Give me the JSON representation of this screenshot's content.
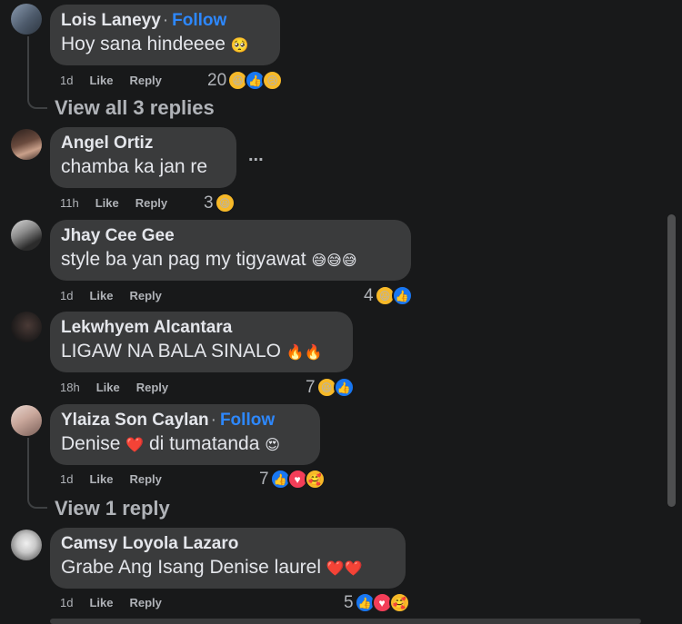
{
  "comments": [
    {
      "author": "Lois Laneyy",
      "follow": "Follow",
      "text": "Hoy sana hindeeee",
      "text_emoji": "🥺",
      "time": "1d",
      "like_label": "Like",
      "reply_label": "Reply",
      "reactions": {
        "count": "20",
        "icons": [
          "haha",
          "like",
          "sad"
        ]
      },
      "view_replies": "View all 3 replies"
    },
    {
      "author": "Angel Ortiz",
      "text": "chamba ka jan re",
      "time": "11h",
      "like_label": "Like",
      "reply_label": "Reply",
      "more": "...",
      "reactions": {
        "count": "3",
        "icons": [
          "haha"
        ]
      }
    },
    {
      "author": "Jhay Cee Gee",
      "text": "style ba yan pag my tigyawat",
      "text_emoji": "😅😅😅",
      "time": "1d",
      "like_label": "Like",
      "reply_label": "Reply",
      "reactions": {
        "count": "4",
        "icons": [
          "haha",
          "like"
        ]
      }
    },
    {
      "author": "Lekwhyem Alcantara",
      "text": "LIGAW NA BALA SINALO",
      "text_emoji": "🔥🔥",
      "time": "18h",
      "like_label": "Like",
      "reply_label": "Reply",
      "reactions": {
        "count": "7",
        "icons": [
          "haha",
          "like"
        ]
      }
    },
    {
      "author": "Ylaiza Son Caylan",
      "follow": "Follow",
      "text_a": "Denise",
      "text_heart": "❤️",
      "text_b": "di tumatanda",
      "text_emoji": "😍",
      "time": "1d",
      "like_label": "Like",
      "reply_label": "Reply",
      "reactions": {
        "count": "7",
        "icons": [
          "like",
          "love",
          "care"
        ]
      },
      "view_replies": "View 1 reply"
    },
    {
      "author": "Camsy Loyola Lazaro",
      "text": "Grabe Ang Isang Denise laurel",
      "text_emoji": "❤️❤️",
      "time": "1d",
      "like_label": "Like",
      "reply_label": "Reply",
      "reactions": {
        "count": "5",
        "icons": [
          "like",
          "love",
          "care"
        ]
      }
    }
  ],
  "icons": {
    "haha": "😆",
    "like": "👍",
    "love": "♥",
    "sad": "😢",
    "care": "🥰"
  },
  "colors": {
    "background": "#18191a",
    "bubble": "#3a3b3c",
    "follow": "#2d88ff",
    "muted": "#b0b3b8"
  }
}
